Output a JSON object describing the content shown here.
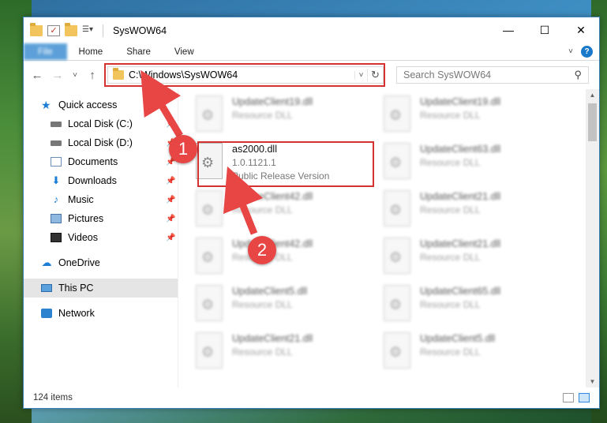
{
  "window": {
    "title": "SysWOW64",
    "controls": {
      "minimize": "—",
      "maximize": "☐",
      "close": "✕"
    }
  },
  "ribbon": {
    "tabs": [
      {
        "label": "File"
      },
      {
        "label": "Home"
      },
      {
        "label": "Share"
      },
      {
        "label": "View"
      }
    ],
    "help": "?"
  },
  "navigation": {
    "back": "←",
    "forward": "→",
    "recent": "˅",
    "up": "↑",
    "address": "C:\\Windows\\SysWOW64",
    "search_placeholder": "Search SysWOW64"
  },
  "sidebar": {
    "items": [
      {
        "label": "Quick access",
        "icon": "star-icon"
      },
      {
        "label": "Local Disk (C:)",
        "icon": "drive-icon"
      },
      {
        "label": "Local Disk (D:)",
        "icon": "drive-icon"
      },
      {
        "label": "Documents",
        "icon": "documents-icon"
      },
      {
        "label": "Downloads",
        "icon": "download-icon"
      },
      {
        "label": "Music",
        "icon": "music-icon"
      },
      {
        "label": "Pictures",
        "icon": "pictures-icon"
      },
      {
        "label": "Videos",
        "icon": "videos-icon"
      },
      {
        "label": "OneDrive",
        "icon": "cloud-icon"
      },
      {
        "label": "This PC",
        "icon": "pc-icon"
      },
      {
        "label": "Network",
        "icon": "network-icon"
      }
    ]
  },
  "files": [
    {
      "name": "UpdateClient19.dll",
      "type": "Resource DLL"
    },
    {
      "name": "UpdateClient19.dll",
      "type": "Resource DLL"
    },
    {
      "name": "as2000.dll",
      "version": "1.0.1121.1",
      "description": "Public Release Version"
    },
    {
      "name": "UpdateClient63.dll",
      "type": "Resource DLL"
    },
    {
      "name": "UpdateClient42.dll",
      "type": "Resource DLL"
    },
    {
      "name": "UpdateClient21.dll",
      "type": "Resource DLL"
    },
    {
      "name": "UpdateClient42.dll",
      "type": "Resource DLL"
    },
    {
      "name": "UpdateClient21.dll",
      "type": "Resource DLL"
    },
    {
      "name": "UpdateClient5.dll",
      "type": "Resource DLL"
    },
    {
      "name": "UpdateClient65.dll",
      "type": "Resource DLL"
    },
    {
      "name": "UpdateClient21.dll",
      "type": "Resource DLL"
    },
    {
      "name": "UpdateClient5.dll",
      "type": "Resource DLL"
    }
  ],
  "status": {
    "item_count": "124 items"
  },
  "annotations": {
    "step1": "1",
    "step2": "2",
    "accent": "#e84545"
  }
}
